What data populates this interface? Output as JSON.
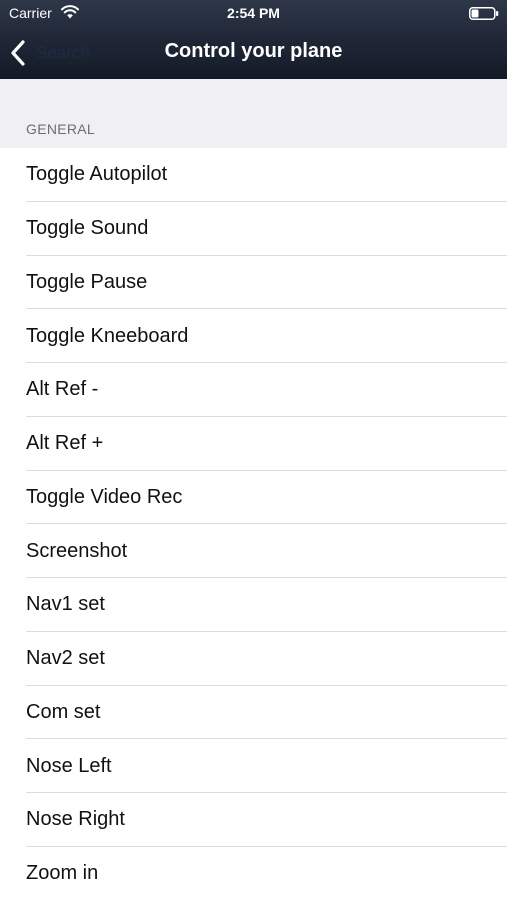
{
  "status_bar": {
    "carrier": "Carrier",
    "time": "2:54 PM"
  },
  "nav": {
    "title": "Control your plane",
    "back_label": "Search",
    "back_icon": "chevron-left-icon"
  },
  "colors": {
    "nav_background": "#1e2636",
    "section_background": "#efeff4",
    "separator": "#dcdce0"
  },
  "section": {
    "header": "GENERAL",
    "items": [
      {
        "label": "Toggle Autopilot"
      },
      {
        "label": "Toggle Sound"
      },
      {
        "label": "Toggle Pause"
      },
      {
        "label": "Toggle Kneeboard"
      },
      {
        "label": "Alt Ref -"
      },
      {
        "label": "Alt Ref +"
      },
      {
        "label": "Toggle Video Rec"
      },
      {
        "label": "Screenshot"
      },
      {
        "label": "Nav1 set"
      },
      {
        "label": "Nav2 set"
      },
      {
        "label": "Com set"
      },
      {
        "label": "Nose Left"
      },
      {
        "label": "Nose Right"
      },
      {
        "label": "Zoom in"
      }
    ]
  }
}
